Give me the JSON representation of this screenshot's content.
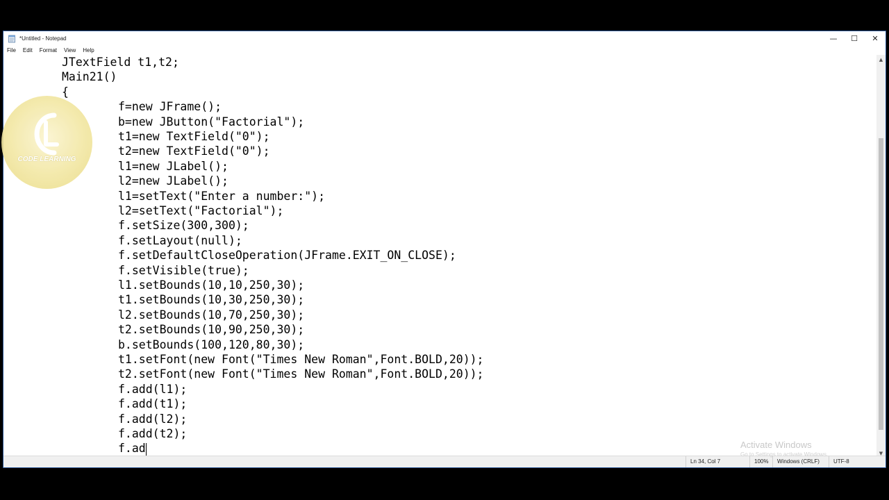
{
  "window": {
    "title": "*Untitled - Notepad",
    "controls": {
      "minimize": "—",
      "maximize": "☐",
      "close": "✕"
    }
  },
  "menu": [
    "File",
    "Edit",
    "Format",
    "View",
    "Help"
  ],
  "code": {
    "top_lines": [
      "JTextField t1,t2;",
      "Main21()",
      "{"
    ],
    "body_lines": [
      "f=new JFrame();",
      "b=new JButton(\"Factorial\");",
      "t1=new TextField(\"0\");",
      "t2=new TextField(\"0\");",
      "l1=new JLabel();",
      "l2=new JLabel();",
      "l1=setText(\"Enter a number:\");",
      "l2=setText(\"Factorial\");",
      "f.setSize(300,300);",
      "f.setLayout(null);",
      "f.setDefaultCloseOperation(JFrame.EXIT_ON_CLOSE);",
      "f.setVisible(true);",
      "l1.setBounds(10,10,250,30);",
      "t1.setBounds(10,30,250,30);",
      "l2.setBounds(10,70,250,30);",
      "t2.setBounds(10,90,250,30);",
      "b.setBounds(100,120,80,30);",
      "t1.setFont(new Font(\"Times New Roman\",Font.BOLD,20));",
      "t2.setFont(new Font(\"Times New Roman\",Font.BOLD,20));",
      "f.add(l1);",
      "f.add(t1);",
      "f.add(l2);",
      "f.add(t2);",
      "f.ad"
    ]
  },
  "status": {
    "position": "Ln 34, Col 7",
    "zoom": "100%",
    "line_ending": "Windows (CRLF)",
    "encoding": "UTF-8"
  },
  "watermark": {
    "text": "CODE LEARNING"
  },
  "activation": {
    "title": "Activate Windows",
    "subtitle": "Go to Settings to activate Windows."
  }
}
